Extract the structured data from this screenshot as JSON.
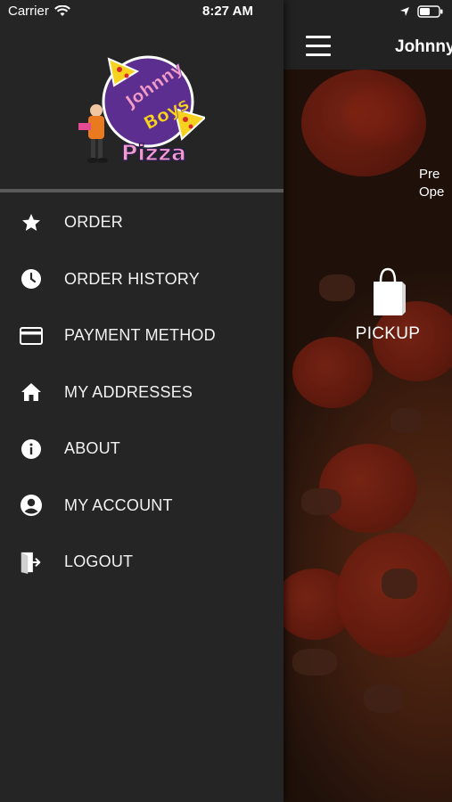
{
  "status_bar": {
    "carrier": "Carrier",
    "time": "8:27 AM"
  },
  "app": {
    "title": "Johnny",
    "hero_line1": "Pre",
    "hero_line2": "Ope",
    "pickup_label": "PICKUP"
  },
  "drawer": {
    "logo": {
      "line1": "Johnny",
      "line2": "Boys",
      "line3": "Pizza"
    },
    "items": [
      {
        "label": "ORDER",
        "icon": "star-icon"
      },
      {
        "label": "ORDER HISTORY",
        "icon": "clock-icon"
      },
      {
        "label": "PAYMENT METHOD",
        "icon": "credit-card-icon"
      },
      {
        "label": "MY ADDRESSES",
        "icon": "home-icon"
      },
      {
        "label": "ABOUT",
        "icon": "info-icon"
      },
      {
        "label": "MY ACCOUNT",
        "icon": "account-circle-icon"
      },
      {
        "label": "LOGOUT",
        "icon": "logout-door-icon"
      }
    ]
  },
  "colors": {
    "drawer_bg": "#252525",
    "header_bg": "#222222",
    "text": "#ffffff"
  }
}
